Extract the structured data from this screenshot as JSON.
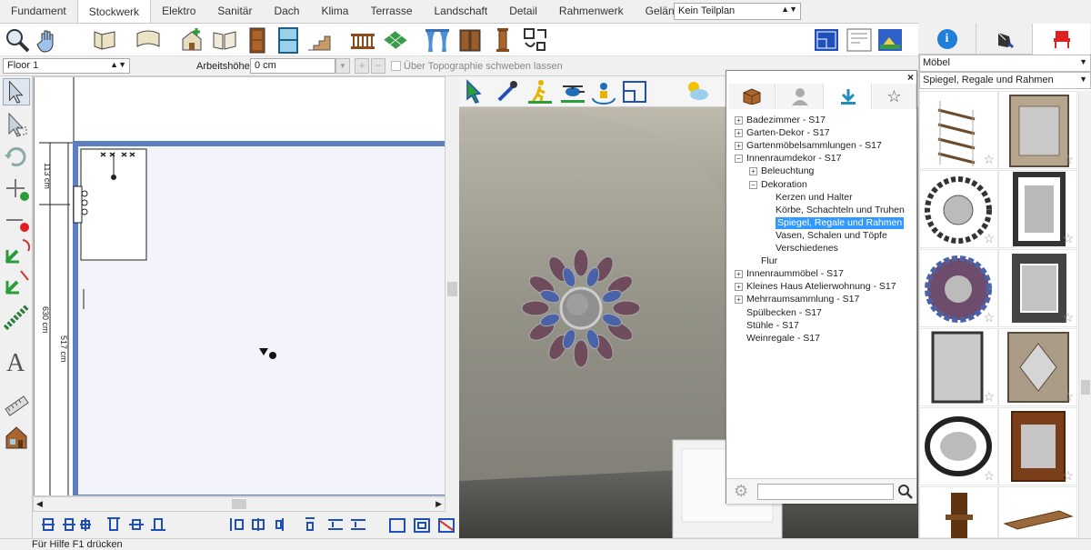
{
  "tabs": [
    "Fundament",
    "Stockwerk",
    "Elektro",
    "Sanitär",
    "Dach",
    "Klima",
    "Terrasse",
    "Landschaft",
    "Detail",
    "Rahmenwerk",
    "Gelände"
  ],
  "active_tab": "Stockwerk",
  "teilplan": "Kein Teilplan",
  "options": {
    "floor": "Floor 1",
    "arbeitshoehe_label": "Arbeitshöhe:",
    "arbeitshoehe_value": "0 cm",
    "topo_label": "Über Topographie schweben lassen"
  },
  "plan": {
    "dim_top": "113 cm",
    "dim_outer": "630 cm",
    "dim_inner": "517 cm"
  },
  "catalog": {
    "tree": [
      {
        "label": "Badezimmer - S17",
        "level": 0,
        "exp": "+"
      },
      {
        "label": "Garten-Dekor - S17",
        "level": 0,
        "exp": "+"
      },
      {
        "label": "Gartenmöbelsammlungen - S17",
        "level": 0,
        "exp": "+"
      },
      {
        "label": "Innenraumdekor - S17",
        "level": 0,
        "exp": "-"
      },
      {
        "label": "Beleuchtung",
        "level": 1,
        "exp": "+"
      },
      {
        "label": "Dekoration",
        "level": 1,
        "exp": "-"
      },
      {
        "label": "Kerzen und Halter",
        "level": 2,
        "exp": ""
      },
      {
        "label": "Körbe, Schachteln und Truhen",
        "level": 2,
        "exp": ""
      },
      {
        "label": "Spiegel, Regale und Rahmen",
        "level": 2,
        "exp": "",
        "selected": true
      },
      {
        "label": "Vasen, Schalen und Töpfe",
        "level": 2,
        "exp": ""
      },
      {
        "label": "Verschiedenes",
        "level": 2,
        "exp": ""
      },
      {
        "label": "Flur",
        "level": 1,
        "exp": ""
      },
      {
        "label": "Innenraummöbel - S17",
        "level": 0,
        "exp": "+"
      },
      {
        "label": "Kleines Haus Atelierwohnung - S17",
        "level": 0,
        "exp": "+"
      },
      {
        "label": "Mehrraumsammlung - S17",
        "level": 0,
        "exp": "+"
      },
      {
        "label": "Spülbecken - S17",
        "level": 0,
        "exp": ""
      },
      {
        "label": "Stühle - S17",
        "level": 0,
        "exp": ""
      },
      {
        "label": "Weinregale - S17",
        "level": 0,
        "exp": ""
      }
    ],
    "search_value": ""
  },
  "right_panel": {
    "category": "Möbel",
    "subcategory": "Spiegel, Regale und Rahmen"
  },
  "status": "Für Hilfe F1 drücken",
  "colors": {
    "accent": "#3399ff",
    "plan_wall": "#5b7fc0",
    "room_fill": "#f3f3fc"
  }
}
